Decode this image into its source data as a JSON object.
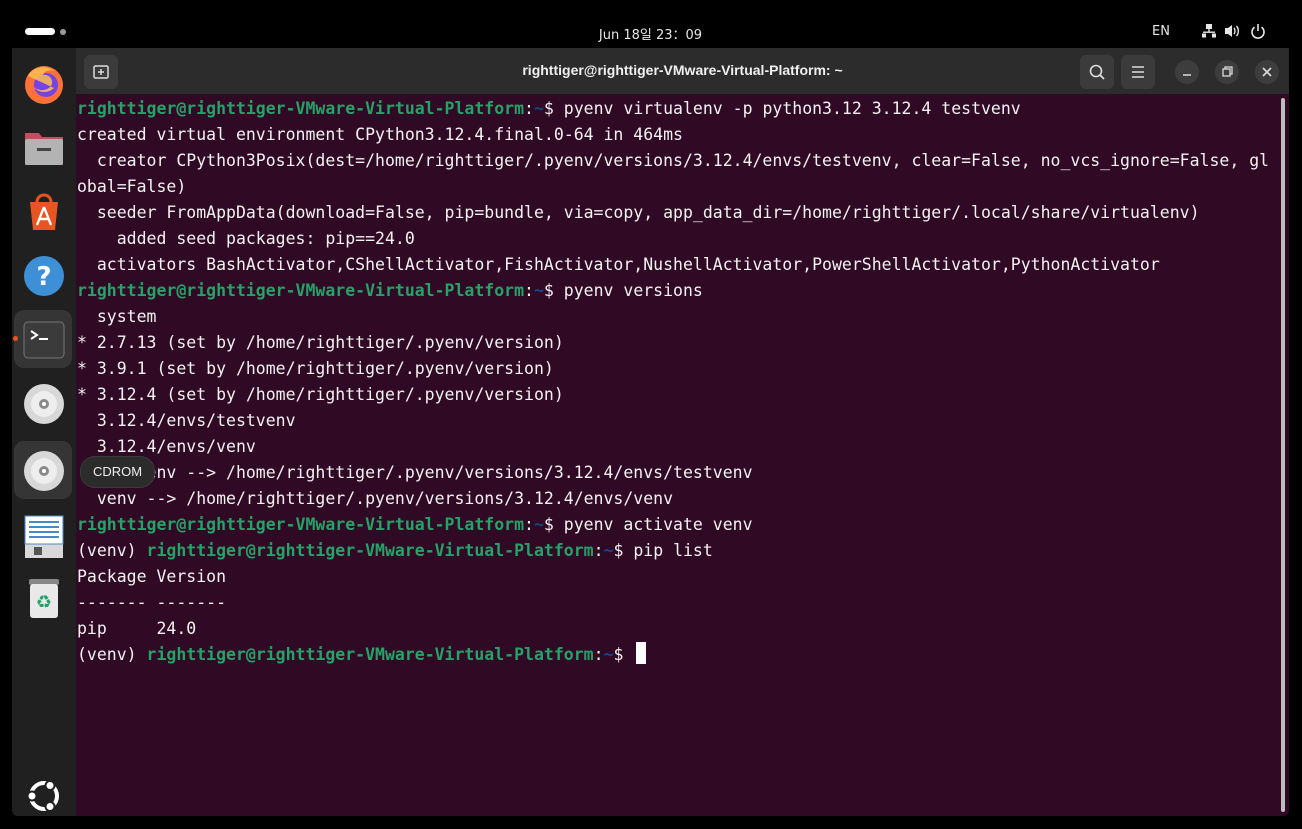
{
  "topbar": {
    "clock": "Jun 18일 23：09",
    "language": "EN"
  },
  "dock": {
    "tooltip": "CDROM",
    "apps": [
      {
        "name": "firefox-icon"
      },
      {
        "name": "files-icon"
      },
      {
        "name": "app-center-icon"
      },
      {
        "name": "help-icon"
      },
      {
        "name": "terminal-icon"
      },
      {
        "name": "cdrom-icon"
      },
      {
        "name": "cdrom-icon"
      },
      {
        "name": "text-editor-icon"
      },
      {
        "name": "trash-icon"
      }
    ]
  },
  "window": {
    "title": "righttiger@righttiger-VMware-Virtual-Platform: ~"
  },
  "terminal": {
    "prompt_user": "righttiger@righttiger-VMware-Virtual-Platform",
    "prompt_sep": ":",
    "prompt_path": "~",
    "prompt_dollar": "$ ",
    "venv_prefix": "(venv) ",
    "cmd1": "pyenv virtualenv -p python3.12 3.12.4 testvenv",
    "out1": "created virtual environment CPython3.12.4.final.0-64 in 464ms",
    "out2": "  creator CPython3Posix(dest=/home/righttiger/.pyenv/versions/3.12.4/envs/testvenv, clear=False, no_vcs_ignore=False, gl",
    "out3": "obal=False)",
    "out4": "  seeder FromAppData(download=False, pip=bundle, via=copy, app_data_dir=/home/righttiger/.local/share/virtualenv)",
    "out5": "    added seed packages: pip==24.0",
    "out6": "  activators BashActivator,CShellActivator,FishActivator,NushellActivator,PowerShellActivator,PythonActivator",
    "cmd2": "pyenv versions",
    "v1": "  system",
    "v2": "* 2.7.13 (set by /home/righttiger/.pyenv/version)",
    "v3": "* 3.9.1 (set by /home/righttiger/.pyenv/version)",
    "v4": "* 3.12.4 (set by /home/righttiger/.pyenv/version)",
    "v5": "  3.12.4/envs/testvenv",
    "v6": "  3.12.4/envs/venv",
    "v7": "  testvenv --> /home/righttiger/.pyenv/versions/3.12.4/envs/testvenv",
    "v8": "  venv --> /home/righttiger/.pyenv/versions/3.12.4/envs/venv",
    "cmd3": "pyenv activate venv",
    "cmd4": "pip list",
    "pip_header": "Package Version",
    "pip_rule": "------- -------",
    "pip_row": "pip     24.0"
  }
}
